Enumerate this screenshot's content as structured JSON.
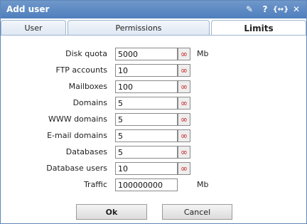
{
  "window": {
    "title": "Add user"
  },
  "title_buttons": [
    {
      "name": "pin-icon",
      "glyph": "✎"
    },
    {
      "name": "help-icon",
      "glyph": "?"
    },
    {
      "name": "maximize-icon",
      "glyph": "{↔}"
    },
    {
      "name": "close-icon",
      "glyph": "✕"
    }
  ],
  "tabs": [
    {
      "label": "User",
      "active": false
    },
    {
      "label": "Permissions",
      "active": false
    },
    {
      "label": "Limits",
      "active": true
    }
  ],
  "fields": [
    {
      "label": "Disk quota",
      "value": "5000",
      "unit": "Mb"
    },
    {
      "label": "FTP accounts",
      "value": "10",
      "unit": ""
    },
    {
      "label": "Mailboxes",
      "value": "100",
      "unit": ""
    },
    {
      "label": "Domains",
      "value": "5",
      "unit": ""
    },
    {
      "label": "WWW domains",
      "value": "5",
      "unit": ""
    },
    {
      "label": "E-mail domains",
      "value": "5",
      "unit": ""
    },
    {
      "label": "Databases",
      "value": "5",
      "unit": ""
    },
    {
      "label": "Database users",
      "value": "10",
      "unit": ""
    },
    {
      "label": "Traffic",
      "value": "100000000",
      "unit": "Mb"
    }
  ],
  "infinity_glyph": "∞",
  "buttons": {
    "ok": "Ok",
    "cancel": "Cancel"
  },
  "colors": {
    "titlebar": "#5a87c2",
    "infinity": "#cc1f1f"
  }
}
